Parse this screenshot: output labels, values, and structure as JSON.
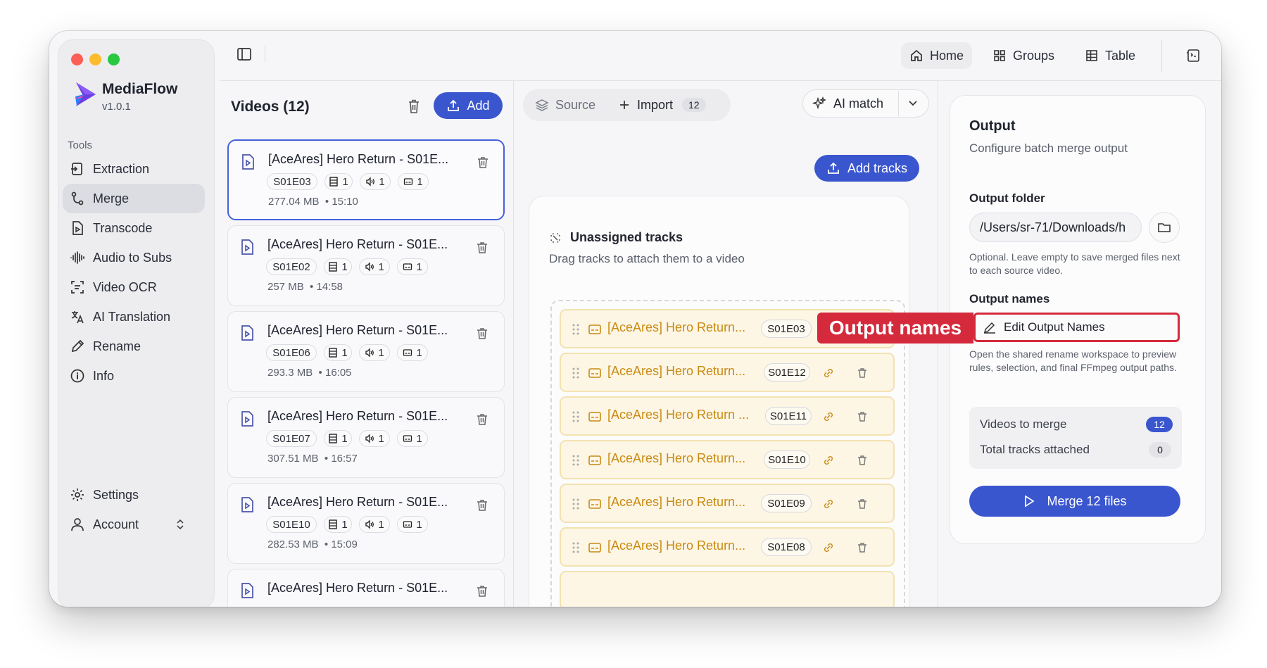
{
  "app": {
    "name": "MediaFlow",
    "version": "v1.0.1"
  },
  "sidebar": {
    "section_label": "Tools",
    "items": [
      {
        "label": "Extraction",
        "icon": "extraction-icon"
      },
      {
        "label": "Merge",
        "icon": "merge-icon",
        "active": true
      },
      {
        "label": "Transcode",
        "icon": "transcode-icon"
      },
      {
        "label": "Audio to Subs",
        "icon": "waveform-icon"
      },
      {
        "label": "Video OCR",
        "icon": "ocr-icon"
      },
      {
        "label": "AI Translation",
        "icon": "translate-icon"
      },
      {
        "label": "Rename",
        "icon": "pencil-icon"
      },
      {
        "label": "Info",
        "icon": "info-icon"
      }
    ],
    "settings_label": "Settings",
    "account_label": "Account"
  },
  "topnav": {
    "home": "Home",
    "groups": "Groups",
    "table": "Table"
  },
  "videos": {
    "header": "Videos (12)",
    "add_label": "Add",
    "items": [
      {
        "title": "[AceAres] Hero Return - S01E...",
        "episode": "S01E03",
        "video": "1",
        "audio": "1",
        "subs": "1",
        "size": "277.04 MB",
        "duration": "15:10"
      },
      {
        "title": "[AceAres] Hero Return - S01E...",
        "episode": "S01E02",
        "video": "1",
        "audio": "1",
        "subs": "1",
        "size": "257 MB",
        "duration": "14:58"
      },
      {
        "title": "[AceAres] Hero Return - S01E...",
        "episode": "S01E06",
        "video": "1",
        "audio": "1",
        "subs": "1",
        "size": "293.3 MB",
        "duration": "16:05"
      },
      {
        "title": "[AceAres] Hero Return - S01E...",
        "episode": "S01E07",
        "video": "1",
        "audio": "1",
        "subs": "1",
        "size": "307.51 MB",
        "duration": "16:57"
      },
      {
        "title": "[AceAres] Hero Return - S01E...",
        "episode": "S01E10",
        "video": "1",
        "audio": "1",
        "subs": "1",
        "size": "282.53 MB",
        "duration": "15:09"
      },
      {
        "title": "[AceAres] Hero Return - S01E...",
        "episode": "",
        "video": "",
        "audio": "",
        "subs": "",
        "size": "",
        "duration": ""
      }
    ]
  },
  "tracks_toolbar": {
    "source_label": "Source",
    "import_label": "Import",
    "import_count": "12",
    "ai_match_label": "AI match"
  },
  "add_tracks_label": "Add tracks",
  "unassigned": {
    "title": "Unassigned tracks",
    "subtitle": "Drag tracks to attach them to a video",
    "tracks": [
      {
        "title": "[AceAres] Hero Return...",
        "episode": "S01E03"
      },
      {
        "title": "[AceAres] Hero Return...",
        "episode": "S01E12"
      },
      {
        "title": "[AceAres] Hero Return ...",
        "episode": "S01E11"
      },
      {
        "title": "[AceAres] Hero Return...",
        "episode": "S01E10"
      },
      {
        "title": "[AceAres] Hero Return...",
        "episode": "S01E09"
      },
      {
        "title": "[AceAres] Hero Return...",
        "episode": "S01E08"
      }
    ]
  },
  "output": {
    "title": "Output",
    "subtitle": "Configure batch merge output",
    "folder_label": "Output folder",
    "folder_value": "/Users/sr-71/Downloads/h",
    "folder_hint": "Optional. Leave empty to save merged files next to each source video.",
    "names_label": "Output names",
    "edit_names_label": "Edit Output Names",
    "names_hint": "Open the shared rename workspace to preview rules, selection, and final FFmpeg output paths.",
    "stats": [
      {
        "label": "Videos to merge",
        "value": "12"
      },
      {
        "label": "Total tracks attached",
        "value": "0"
      }
    ],
    "merge_label": "Merge 12 files"
  },
  "annotation": {
    "label": "Output names",
    "color": "#d42a3c"
  },
  "colors": {
    "accent": "#3a56cf",
    "track_text": "#c98a12"
  }
}
